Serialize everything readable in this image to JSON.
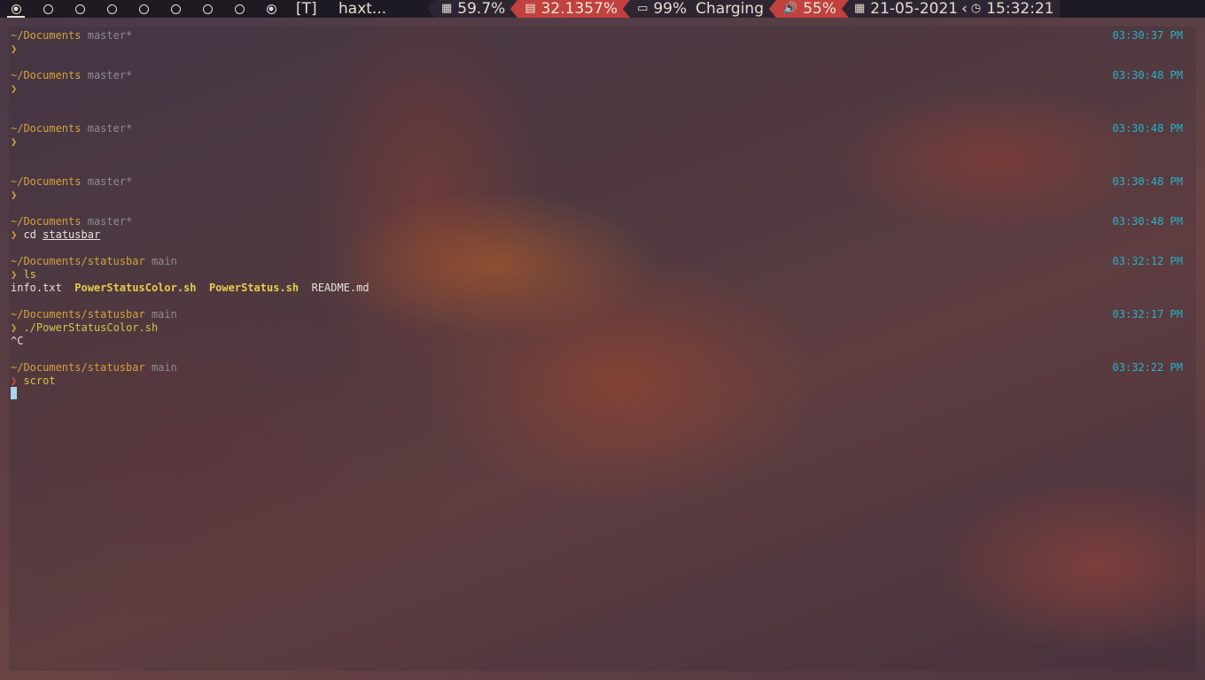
{
  "topbar": {
    "workspaces": [
      "1",
      "2",
      "3",
      "4",
      "5",
      "6",
      "7",
      "8",
      "9"
    ],
    "layout": "[T]",
    "window_title": "haxt...",
    "cpu": "59.7%",
    "memory": "32.1357%",
    "battery_level": "99%",
    "battery_status": "Charging",
    "volume": "55%",
    "date": "21-05-2021",
    "time": "15:32:21",
    "colors": {
      "bar_bg": "#1e1a24",
      "accent_red": "#c0413e",
      "text": "#e6dccf"
    }
  },
  "terminal": {
    "blocks": [
      {
        "path": "~/Documents",
        "branch": "master*",
        "command": "",
        "time": "03:30:37 PM"
      },
      {
        "path": "~/Documents",
        "branch": "master*",
        "command": "",
        "time": "03:30:48 PM"
      },
      {
        "path": "~/Documents",
        "branch": "master*",
        "command": "",
        "time": "03:30:48 PM"
      },
      {
        "path": "~/Documents",
        "branch": "master*",
        "command": "",
        "time": "03:30:48 PM"
      },
      {
        "path": "~/Documents",
        "branch": "master*",
        "command": "cd",
        "arg": "statusbar",
        "time": "03:30:48 PM"
      },
      {
        "path": "~/Documents/statusbar",
        "branch": "main",
        "command": "ls",
        "time": "03:32:12 PM",
        "output": [
          "info.txt",
          "PowerStatusColor.sh",
          "PowerStatus.sh",
          "README.md"
        ]
      },
      {
        "path": "~/Documents/statusbar",
        "branch": "main",
        "command": "./PowerStatusColor.sh",
        "time": "03:32:17 PM",
        "output_text": "^C"
      },
      {
        "path": "~/Documents/statusbar",
        "branch": "main",
        "command": "scrot",
        "time": "03:32:22 PM"
      }
    ],
    "prompt_symbol": "❯"
  }
}
